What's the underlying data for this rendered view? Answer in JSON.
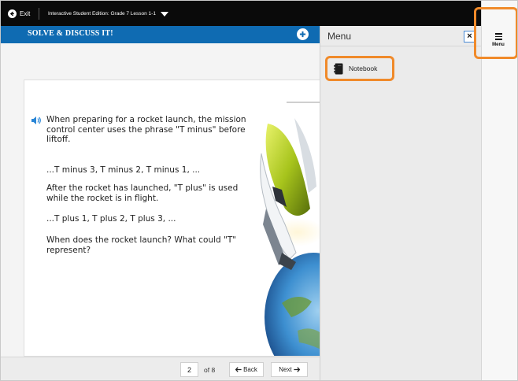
{
  "topbar": {
    "exit_label": "Exit",
    "edition_label": "Interactive Student Edition: Grade 7 Lesson 1-1"
  },
  "header": {
    "section_title": "SOLVE & DISCUSS IT!"
  },
  "problem": {
    "p1": "When preparing for a rocket launch, the mission control center uses the phrase \"T minus\" before liftoff.",
    "p2": "...T minus 3, T minus 2, T minus 1, ...",
    "p3": "After the rocket has launched, \"T plus\" is used while the rocket is in flight.",
    "p4": "...T plus 1, T plus 2, T plus 3, ...",
    "p5": "When does the rocket launch? What could \"T\" represent?"
  },
  "pager": {
    "current_page": "2",
    "of_label": "of 8",
    "back_label": "Back",
    "next_label": "Next"
  },
  "menu": {
    "title": "Menu",
    "close_label": "×",
    "items": [
      {
        "label": "Notebook"
      }
    ],
    "toggle_label": "Menu"
  },
  "colors": {
    "header_blue": "#0f6bb2",
    "highlight_orange": "#f08a2a",
    "top_bar": "#0a0a0a"
  },
  "icons": {
    "exit": "arrow-left-circle-icon",
    "dropdown": "caret-down-icon",
    "add": "plus-circle-icon",
    "audio": "speaker-icon",
    "notebook": "notebook-icon",
    "menu": "hamburger-icon"
  }
}
